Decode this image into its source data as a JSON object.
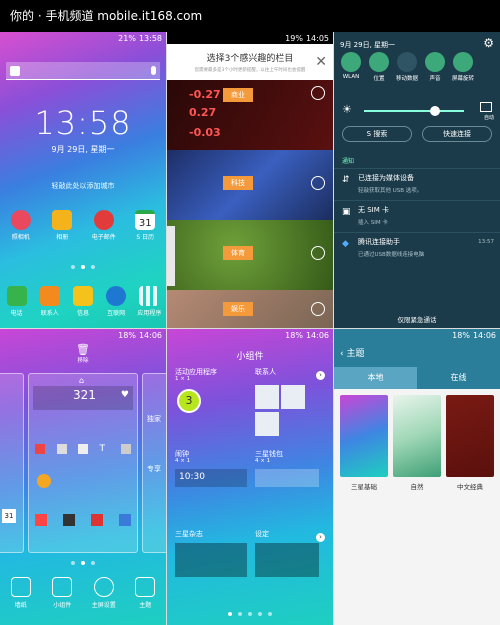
{
  "watermark": "你的 · 手机频道 mobile.it168.com",
  "panel1": {
    "status_time": "13:58",
    "status_battery": "21%",
    "clock": "13:58",
    "date": "9月 29日, 星期一",
    "weather_hint": "轻敲此处以添加城市",
    "apps_row1": [
      "照相机",
      "相册",
      "电子邮件",
      "S 日历"
    ],
    "calendar_day": "31",
    "apps_row2": [
      "电话",
      "联系人",
      "信息",
      "互联网",
      "应用程序"
    ]
  },
  "panel2": {
    "status_time": "14:05",
    "status_battery": "19%",
    "title": "选择3个感兴趣的栏目",
    "subtitle": "您需要最多是3个小时更新提醒，以往上午时间也会提醒",
    "categories": [
      "商业",
      "科技",
      "体育",
      "娱乐"
    ],
    "stock_values": [
      "-0.27",
      "-0.03",
      "0.27"
    ]
  },
  "panel3": {
    "date": "9月 29日, 星期一",
    "quick_settings": [
      "WLAN",
      "位置",
      "移动数据",
      "声音",
      "屏幕旋转"
    ],
    "auto_label": "自动",
    "s_finder": "S 搜索",
    "quick_connect": "快速连接",
    "section": "通知",
    "notifications": [
      {
        "title": "已连接为媒体设备",
        "sub": "轻敲获取其他 USB 选项。",
        "time": ""
      },
      {
        "title": "无 SIM 卡",
        "sub": "插入 SIM 卡",
        "time": ""
      },
      {
        "title": "腾讯连接助手",
        "sub": "已通过USB数据线连接电脑",
        "time": "13:57"
      }
    ],
    "emergency": "仅限紧急通话"
  },
  "panel4": {
    "status_time": "14:06",
    "status_battery": "18%",
    "remove": "移除",
    "weather_temp": "321",
    "tray": [
      "墙纸",
      "小组件",
      "主屏设置",
      "主题"
    ],
    "cal_day": "31",
    "side_text1": "独家",
    "side_text2": "专享"
  },
  "panel5": {
    "status_time": "14:06",
    "status_battery": "18%",
    "title": "小组件",
    "widgets": [
      {
        "name": "活动应用程序",
        "size": "1 × 1"
      },
      {
        "name": "联系人",
        "size": ""
      },
      {
        "name": "闹钟",
        "size": "4 × 1"
      },
      {
        "name": "三星钱包",
        "size": "4 × 1"
      },
      {
        "name": "三星杂志",
        "size": ""
      },
      {
        "name": "设定",
        "size": ""
      }
    ],
    "active_count": "3",
    "alarm_time": "10:30"
  },
  "panel6": {
    "status_time": "14:06",
    "status_battery": "18%",
    "title": "主题",
    "tabs": [
      "本地",
      "在线"
    ],
    "themes": [
      "三星基础",
      "自然",
      "中文经典"
    ]
  },
  "colors": {
    "accent": "#3da97a",
    "tab_active": "#5aa5c1"
  }
}
